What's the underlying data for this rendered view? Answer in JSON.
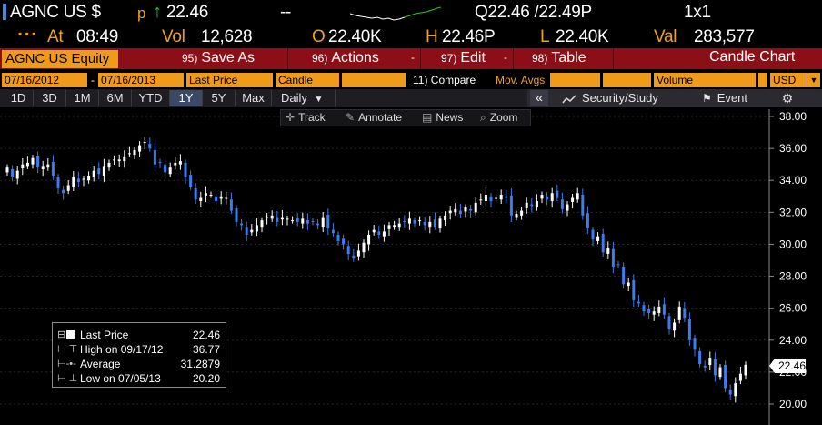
{
  "header": {
    "ticker": "AGNC US $",
    "flag": "p",
    "arrow": "↑",
    "last": "22.46",
    "change": "--",
    "bid_ask": "Q22.46 /22.49P",
    "size": "1x1",
    "at_label": "At",
    "time": "08:49",
    "vol_label": "Vol",
    "volume": "12,628",
    "open_label": "O",
    "open": "22.40K",
    "high_label": "H",
    "high": "22.46P",
    "low_label": "L",
    "low": "22.40K",
    "val_label": "Val",
    "value": "283,577"
  },
  "function_bar": {
    "security": "AGNC US Equity",
    "buttons": [
      {
        "num": "95)",
        "label": "Save As"
      },
      {
        "num": "96)",
        "label": "Actions"
      },
      {
        "num": "97)",
        "label": "Edit"
      },
      {
        "num": "98)",
        "label": "Table"
      }
    ],
    "chart_type": "Candle Chart"
  },
  "params": {
    "start_date": "07/16/2012",
    "dash": "-",
    "end_date": "07/16/2013",
    "field": "Last Price",
    "style": "Candle",
    "compare": "11) Compare",
    "mov_avgs": "Mov. Avgs",
    "volume": "Volume",
    "currency": "USD"
  },
  "ranges": {
    "items": [
      "1D",
      "3D",
      "1M",
      "6M",
      "YTD",
      "1Y",
      "5Y",
      "Max"
    ],
    "selected": "1Y",
    "period": "Daily",
    "collapse": "«",
    "security_study": "Security/Study",
    "event": "Event"
  },
  "tools": {
    "track": "Track",
    "annotate": "Annotate",
    "news": "News",
    "zoom": "Zoom"
  },
  "legend": [
    {
      "name": "Last Price",
      "value": "22.46"
    },
    {
      "name": "High on 09/17/12",
      "value": "36.77"
    },
    {
      "name": "Average",
      "value": "31.2879"
    },
    {
      "name": "Low on 07/05/13",
      "value": "20.20"
    }
  ],
  "colors": {
    "up_candle": "#ffffff",
    "down_candle": "#3b7cf0",
    "function_bar": "#8c0e16",
    "field_amber": "#f09a1c",
    "text_amber": "#f0a21e"
  },
  "chart_data": {
    "type": "candlestick",
    "x_range": [
      "07/16/2012",
      "07/16/2013"
    ],
    "ylim": [
      20,
      38
    ],
    "yticks": [
      "38.00",
      "36.00",
      "34.00",
      "32.00",
      "30.00",
      "28.00",
      "26.00",
      "24.00",
      "22.00",
      "20.00"
    ],
    "last_price_tag": "22.46",
    "close": [
      34.8,
      34.2,
      34.6,
      35.0,
      35.1,
      35.4,
      34.8,
      34.9,
      35.0,
      34.3,
      33.5,
      33.2,
      33.7,
      34.2,
      33.9,
      34.1,
      34.3,
      34.6,
      34.4,
      34.9,
      35.1,
      35.3,
      35.3,
      35.5,
      35.7,
      35.9,
      36.2,
      36.4,
      36.0,
      35.0,
      35.1,
      34.5,
      34.8,
      35.1,
      35.2,
      34.2,
      33.6,
      32.8,
      32.9,
      33.2,
      33.1,
      32.7,
      33.0,
      32.9,
      32.1,
      31.4,
      31.2,
      30.6,
      30.9,
      31.2,
      31.5,
      31.7,
      31.8,
      31.4,
      31.7,
      31.6,
      31.5,
      31.4,
      31.6,
      31.3,
      31.4,
      31.2,
      31.7,
      31.0,
      30.7,
      30.2,
      30.0,
      29.4,
      29.1,
      29.6,
      30.1,
      30.6,
      30.9,
      30.6,
      30.8,
      31.2,
      31.2,
      31.3,
      31.4,
      31.6,
      31.3,
      31.5,
      31.2,
      31.4,
      31.1,
      31.6,
      31.8,
      32.1,
      32.2,
      31.9,
      32.3,
      32.1,
      32.6,
      32.8,
      33.1,
      32.7,
      32.9,
      33.1,
      32.9,
      31.8,
      31.9,
      32.1,
      32.6,
      32.4,
      32.7,
      33.1,
      32.8,
      33.2,
      32.9,
      32.2,
      32.5,
      32.9,
      33.2,
      31.8,
      31.0,
      30.3,
      30.5,
      29.5,
      29.8,
      28.6,
      28.7,
      27.5,
      27.6,
      26.5,
      26.3,
      25.8,
      25.7,
      25.8,
      26.1,
      25.6,
      24.7,
      25.1,
      26.1,
      25.4,
      24.0,
      23.4,
      22.5,
      22.3,
      22.9,
      21.8,
      22.3,
      21.0,
      20.6,
      21.3,
      21.9,
      22.46
    ]
  }
}
